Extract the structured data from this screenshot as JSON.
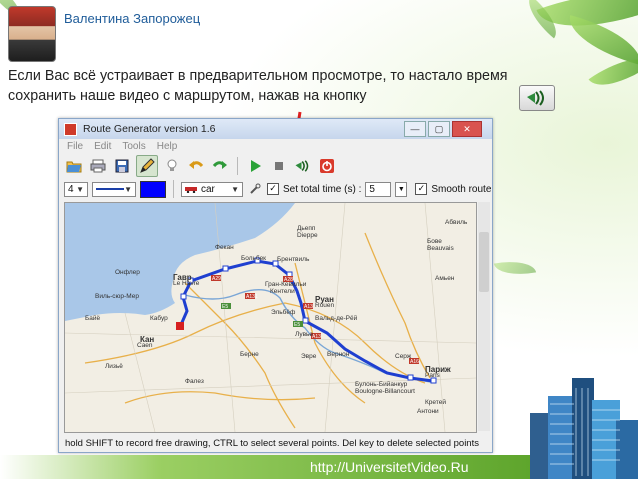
{
  "slide": {
    "author": "Валентина Запорожец",
    "instruction": "Если Вас всё устраивает в предварительном просмотре, то настало время сохранить наше видео с маршрутом, нажав на кнопку",
    "footer_url": "http://UniversitetVideo.Ru"
  },
  "app": {
    "title": "Route Generator version 1.6",
    "menu": [
      "File",
      "Edit",
      "Tools",
      "Help"
    ],
    "toolbar2": {
      "line_width": "4",
      "vehicle": "car",
      "set_total_time_label": "Set total time (s) :",
      "total_time_value": "5",
      "smooth_route_label": "Smooth route",
      "route_color": "#0000ff"
    },
    "status": "hold SHIFT to record free drawing, CTRL to select several points. Del key to delete selected points"
  },
  "map_labels": [
    "Дьепп",
    "Dieppe",
    "Фекан",
    "Больбек",
    "Гавр",
    "Le Havre",
    "Брентвиль",
    "Руан",
    "Rouen",
    "Онфлер",
    "Кан",
    "Caen",
    "Эльбёф",
    "Лувье",
    "Эвре",
    "Вернон",
    "Париж",
    "Paris",
    "Кретей",
    "Антони",
    "Бове",
    "Beauvais",
    "Лизьё",
    "Берне",
    "Булонь-Бийанкур",
    "Boulogne-Billancourt",
    "Серж",
    "Абвиль",
    "Амьен",
    "Вальд-де-Рёй",
    "Кабур",
    "Байё",
    "Виль-сюр-Мер",
    "Кентели",
    "Фалез",
    "Гран-Кевильи"
  ]
}
